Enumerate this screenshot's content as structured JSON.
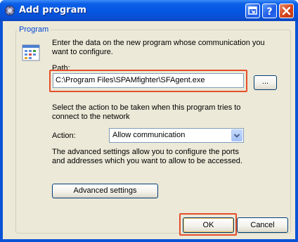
{
  "window": {
    "title": "Add program"
  },
  "group": {
    "label": "Program"
  },
  "intro": {
    "line1": "Enter the data on the new program whose communication you",
    "line2": "want to configure."
  },
  "path": {
    "label": "Path:",
    "value": "C:\\Program Files\\SPAMfighter\\SFAgent.exe",
    "browse_label": "..."
  },
  "action_desc": {
    "line1": "Select the action to be taken when this program tries to",
    "line2": "connect to the network"
  },
  "action": {
    "label": "Action:",
    "selected": "Allow communication"
  },
  "advanced_desc": {
    "line1": "The advanced settings allow you to configure the ports",
    "line2": "and addresses which you want to allow to be accessed."
  },
  "buttons": {
    "advanced": "Advanced settings",
    "ok": "OK",
    "cancel": "Cancel"
  },
  "colors": {
    "highlight": "#e34f2a",
    "titlebar": "#0556e2",
    "group_label": "#0046d5"
  },
  "icons": {
    "app": "app-icon",
    "program": "program-window-icon",
    "help": "help-icon",
    "close": "close-icon",
    "context": "context-help-icon",
    "dropdown": "chevron-down-icon"
  }
}
